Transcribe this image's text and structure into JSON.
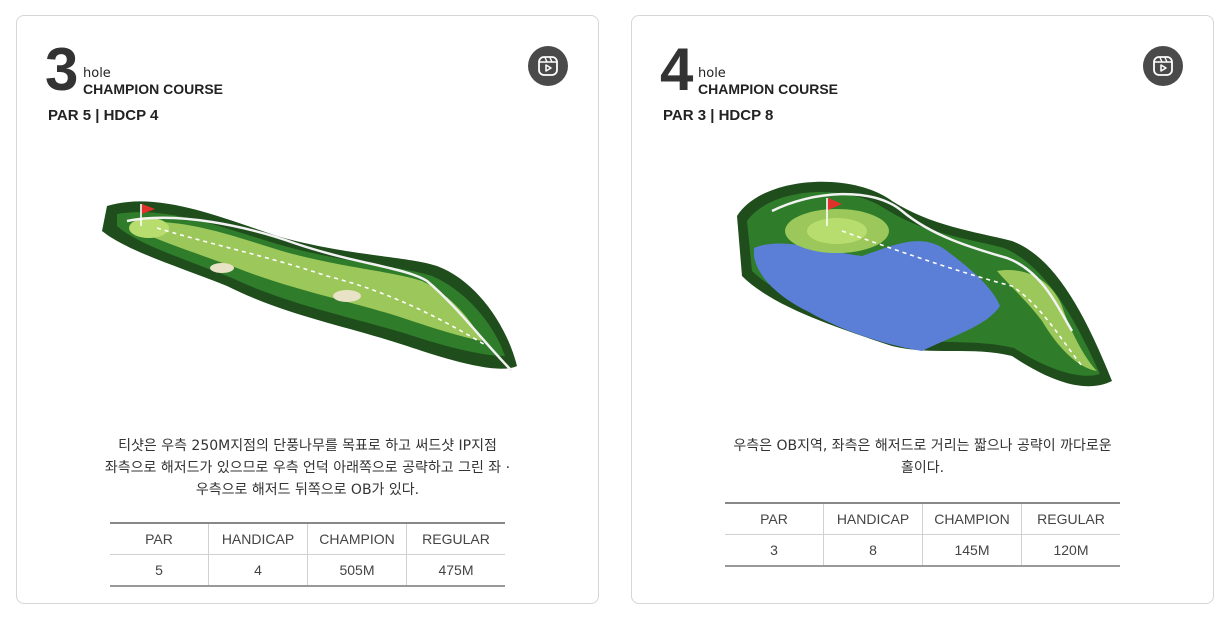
{
  "holes": [
    {
      "number": "3",
      "hole_label": "hole",
      "course": "CHAMPION COURSE",
      "par_hdcp": "PAR 5 | HDCP 4",
      "video_icon": "play-video-icon",
      "description": "티샷은 우측 250M지점의 단풍나무를 목표로 하고 써드샷 IP지점\n좌측으로 해저드가 있으므로 우측 언덕 아래쪽으로 공략하고 그린 좌 ·\n우측으로 해저드 뒤쪽으로 OB가 있다.",
      "table": {
        "headers": [
          "PAR",
          "HANDICAP",
          "CHAMPION",
          "REGULAR"
        ],
        "values": [
          "5",
          "4",
          "505M",
          "475M"
        ]
      }
    },
    {
      "number": "4",
      "hole_label": "hole",
      "course": "CHAMPION COURSE",
      "par_hdcp": "PAR 3 | HDCP 8",
      "video_icon": "play-video-icon",
      "description": "우측은 OB지역, 좌측은 해저드로 거리는 짧으나 공략이 까다로운\n홀이다.",
      "table": {
        "headers": [
          "PAR",
          "HANDICAP",
          "CHAMPION",
          "REGULAR"
        ],
        "values": [
          "3",
          "8",
          "145M",
          "120M"
        ]
      }
    }
  ],
  "colors": {
    "fairway": "#9cc75a",
    "rough": "#2f7d2a",
    "trees": "#1f4d1c",
    "water": "#5b7fd6",
    "flag": "#e0322b"
  }
}
